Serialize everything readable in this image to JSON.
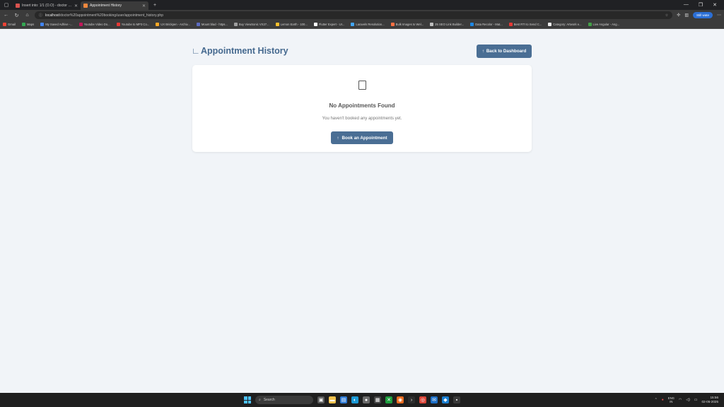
{
  "browser": {
    "tabs": [
      {
        "label": "Insert into: 1/1 (O.O) - doctor app",
        "color": "#d9534f",
        "active": false
      },
      {
        "label": "Appointment History",
        "color": "#f0883e",
        "active": true
      }
    ],
    "url_host": "localhost",
    "url_path": "/doctor%20appointment%20booking/user/appointment_history.php",
    "profile_label": "Still wate",
    "bookmarks": [
      {
        "label": "Gmail",
        "color": "#ea4335"
      },
      {
        "label": "Maps",
        "color": "#34a853"
      },
      {
        "label": "My Saved Adhive -...",
        "color": "#4285f4"
      },
      {
        "label": "Youtube Video Do...",
        "color": "#c2185b"
      },
      {
        "label": "Youtube to MP3 Co...",
        "color": "#e53935"
      },
      {
        "label": "UX Brickpen - Archiv...",
        "color": "#f9a825"
      },
      {
        "label": "Mount blad - https...",
        "color": "#5c6bc0"
      },
      {
        "label": "Buy ViewSonic VX27...",
        "color": "#9e9e9e"
      },
      {
        "label": "Lemon Earth - 100...",
        "color": "#fbc02d"
      },
      {
        "label": "Flutter Expert - Ur...",
        "color": "#ffffff"
      },
      {
        "label": "Laravels Resolution...",
        "color": "#42a5f5"
      },
      {
        "label": "Bulk Images to Wel...",
        "color": "#ff7043"
      },
      {
        "label": "25 SEO Link Builder...",
        "color": "#bdbdbd"
      },
      {
        "label": "Data Recolor - Mat...",
        "color": "#1e88e5"
      },
      {
        "label": "Best RTI to Send C...",
        "color": "#e53935"
      },
      {
        "label": "Category: Artwork e...",
        "color": "#eeeeee"
      },
      {
        "label": "Live Angular - Ang...",
        "color": "#43a047"
      }
    ]
  },
  "page": {
    "title": "Appointment History",
    "back_button_label": "Back to Dashboard",
    "empty_state": {
      "title": "No Appointments Found",
      "message": "You haven't booked any appointments yet.",
      "cta_label": "Book an Appointment"
    }
  },
  "taskbar": {
    "search_placeholder": "Search",
    "lang_top": "ENG",
    "lang_bottom": "IN",
    "time": "15:56",
    "date": "02-05-2025"
  }
}
